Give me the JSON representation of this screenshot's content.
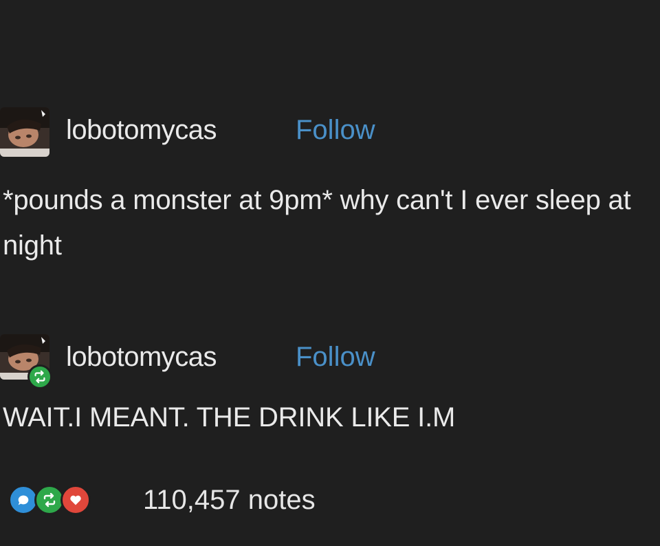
{
  "posts": [
    {
      "username": "lobotomycas",
      "follow_label": "Follow",
      "text": "*pounds a monster at 9pm* why can't I ever sleep at night"
    },
    {
      "username": "lobotomycas",
      "follow_label": "Follow",
      "text": "WAIT.I MEANT. THE DRINK LIKE I.M",
      "reblog_indicator": "reblog-icon"
    }
  ],
  "notes": {
    "count_label": "110,457 notes",
    "icons": [
      "reply-icon",
      "reblog-icon",
      "like-icon"
    ]
  },
  "colors": {
    "background": "#1f1f1f",
    "text": "#eaeaea",
    "follow": "#4a90c8",
    "reply": "#2f8fd8",
    "reblog": "#2ea84a",
    "like": "#e0473b"
  }
}
